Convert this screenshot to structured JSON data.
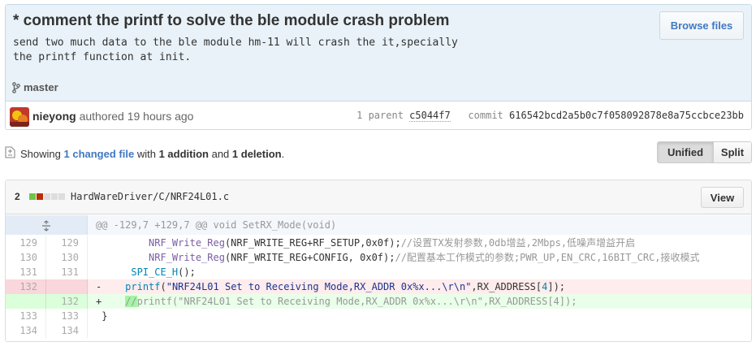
{
  "commit": {
    "title": "* comment the printf to solve the ble module crash problem",
    "description": "send two much data to the ble module hm-11 will crash the it,specially\nthe printf function at init.",
    "browse_label": "Browse files",
    "branch": "master",
    "author": "nieyong",
    "authored_text": "authored 19 hours ago",
    "parent_label": "1 parent",
    "parent_sha": "c5044f7",
    "commit_label": "commit",
    "commit_sha": "616542bcd2a5b0c7f058092878e8a75ccbce23bb"
  },
  "toc": {
    "showing": "Showing",
    "changed": "1 changed file",
    "with": "with",
    "additions": "1 addition",
    "and": "and",
    "deletions": "1 deletion",
    "period": ".",
    "unified_label": "Unified",
    "split_label": "Split"
  },
  "file": {
    "change_count": "2",
    "path": "HardWareDriver/C/NRF24L01.c",
    "view_label": "View",
    "diffstat_colors": [
      "#6cc644",
      "#bd2c00",
      "#dddddd",
      "#dddddd",
      "#dddddd"
    ]
  },
  "diff": {
    "hunk": "@@ -129,7 +129,7 @@ void SetRX_Mode(void)",
    "lines": [
      {
        "type": "ctx",
        "old": "129",
        "new": "129",
        "sign": " ",
        "fn": "NRF_Write_Reg",
        "rest": "(NRF_WRITE_REG+RF_SETUP,0x0f);",
        "comment": "//设置TX发射参数,0db增益,2Mbps,低噪声增益开启",
        "indent": "        "
      },
      {
        "type": "ctx",
        "old": "130",
        "new": "130",
        "sign": " ",
        "fn": "NRF_Write_Reg",
        "rest": "(NRF_WRITE_REG+CONFIG, 0x0f);",
        "comment": "//配置基本工作模式的参数;PWR_UP,EN_CRC,16BIT_CRC,接收模式",
        "indent": "        "
      },
      {
        "type": "ctx",
        "old": "131",
        "new": "131",
        "sign": " ",
        "fn": "SPI_CE_H",
        "rest": "();",
        "comment": "",
        "indent": "     "
      },
      {
        "type": "del",
        "old": "132",
        "new": "",
        "sign": "-",
        "fn": "printf",
        "str": "\"NRF24L01 Set to Receiving Mode,RX_ADDR 0x%x...\\r\\n\"",
        "rest2": ",RX_ADDRESS[",
        "num": "4",
        "rest3": "]);",
        "indent": "    "
      },
      {
        "type": "add",
        "old": "",
        "new": "132",
        "sign": "+",
        "hl": "//",
        "comment": "printf(\"NRF24L01 Set to Receiving Mode,RX_ADDR 0x%x...\\r\\n\",RX_ADDRESS[4]);",
        "indent": "    "
      },
      {
        "type": "ctx",
        "old": "133",
        "new": "133",
        "sign": " ",
        "plain": "}",
        "indent": ""
      },
      {
        "type": "ctx",
        "old": "134",
        "new": "134",
        "sign": " ",
        "plain": "",
        "indent": ""
      }
    ]
  },
  "icons": {
    "branch": "branch-icon",
    "expand": "unfold-icon",
    "file": "file-diff-icon"
  }
}
